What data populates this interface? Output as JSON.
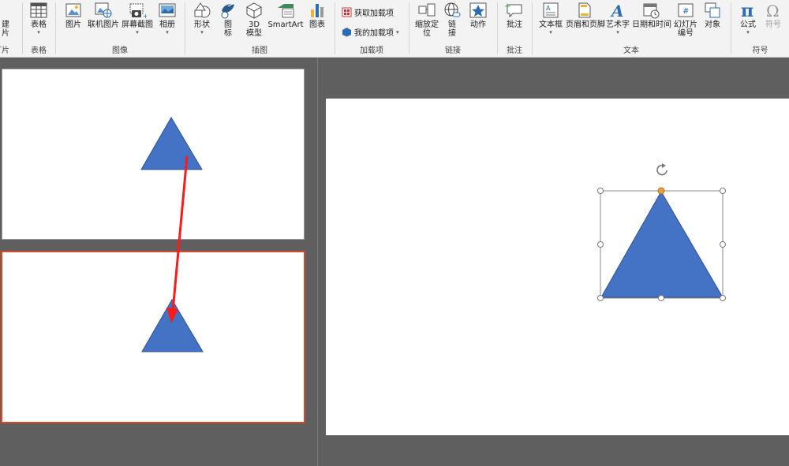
{
  "ribbon": {
    "groups": {
      "slides": {
        "label": "灯片",
        "new_slide_label_line1": "建",
        "new_slide_label_line2": "片"
      },
      "tables": {
        "label": "表格",
        "table_label": "表格"
      },
      "images": {
        "label": "图像",
        "picture_label": "图片",
        "online_picture_label": "联机图片",
        "screenshot_label": "屏幕截图",
        "album_label": "相册"
      },
      "illustrations": {
        "label": "插图",
        "shapes_label": "形状",
        "icons_label_line1": "图",
        "icons_label_line2": "标",
        "model3d_label_line1": "3D",
        "model3d_label_line2": "模型",
        "smartart_label": "SmartArt",
        "chart_label": "图表"
      },
      "addins": {
        "label": "加载项",
        "get_addins_label": "获取加载项",
        "my_addins_label": "我的加载项"
      },
      "links": {
        "label": "链接",
        "zoom_label_line1": "缩放定",
        "zoom_label_line2": "位",
        "link_label_line1": "链",
        "link_label_line2": "接",
        "action_label": "动作"
      },
      "comments": {
        "label": "批注",
        "comment_label": "批注"
      },
      "text": {
        "label": "文本",
        "textbox_label": "文本框",
        "header_footer_label": "页眉和页脚",
        "wordart_label": "艺术字",
        "datetime_label": "日期和时间",
        "slide_number_label_line1": "幻灯片",
        "slide_number_label_line2": "编号",
        "object_label": "对象"
      },
      "symbols": {
        "label": "符号",
        "equation_label": "公式",
        "symbol_label": "符号"
      }
    }
  },
  "colors": {
    "shape_fill": "#4472c4",
    "shape_stroke": "#2f528f",
    "selected_thumb_border": "#d8472a",
    "annotation_arrow": "#ff1a1a",
    "handle_rotate": "#e8a040"
  },
  "icons": {
    "slide": "new-slide-icon",
    "table": "table-icon",
    "picture": "picture-icon",
    "online_picture": "online-picture-icon",
    "screenshot": "screenshot-icon",
    "album": "album-icon",
    "shapes": "shapes-icon",
    "icons": "icons-icon",
    "model3d": "3d-model-icon",
    "smartart": "smartart-icon",
    "chart": "chart-icon",
    "store": "store-icon",
    "my_addins": "my-addins-icon",
    "zoom": "zoom-icon",
    "link": "link-icon",
    "action": "action-icon",
    "comment": "comment-icon",
    "textbox": "textbox-icon",
    "header_footer": "header-footer-icon",
    "wordart": "wordart-icon",
    "datetime": "datetime-icon",
    "slide_number": "slide-number-icon",
    "object": "object-icon",
    "equation": "equation-icon",
    "symbol": "symbol-icon"
  }
}
